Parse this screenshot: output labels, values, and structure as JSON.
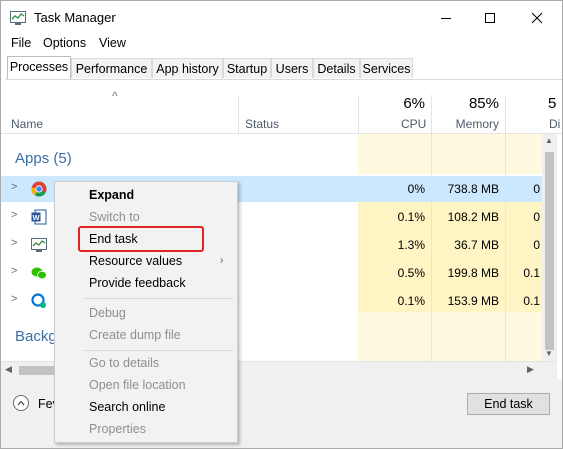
{
  "window": {
    "title": "Task Manager",
    "minimize_glyph": "—",
    "maximize_glyph": "☐",
    "close_glyph": "✕"
  },
  "menu": [
    "File",
    "Options",
    "View"
  ],
  "tabs": [
    "Processes",
    "Performance",
    "App history",
    "Startup",
    "Users",
    "Details",
    "Services"
  ],
  "columns": {
    "sort_glyph": "^",
    "name": "Name",
    "status": "Status",
    "cpu": {
      "pct": "6%",
      "label": "CPU"
    },
    "memory": {
      "pct": "85%",
      "label": "Memory"
    },
    "disk": {
      "pct": "5",
      "label": "Di"
    }
  },
  "groups": {
    "apps": "Apps (5)",
    "background": "Backg"
  },
  "rows": [
    {
      "icon": "chrome-icon",
      "cpu": "0%",
      "memory": "738.8 MB",
      "disk": "0"
    },
    {
      "icon": "word-icon",
      "cpu": "0.1%",
      "memory": "108.2 MB",
      "disk": "0"
    },
    {
      "icon": "task-manager-icon",
      "cpu": "1.3%",
      "memory": "36.7 MB",
      "disk": "0"
    },
    {
      "icon": "wechat-icon",
      "cpu": "0.5%",
      "memory": "199.8 MB",
      "disk": "0.1"
    },
    {
      "icon": "snipping-icon",
      "cpu": "0.1%",
      "memory": "153.9 MB",
      "disk": "0.1"
    }
  ],
  "context_menu": {
    "expand": "Expand",
    "switch_to": "Switch to",
    "end_task": "End task",
    "resource_values": "Resource values",
    "provide_feedback": "Provide feedback",
    "debug": "Debug",
    "create_dump": "Create dump file",
    "go_to_details": "Go to details",
    "open_file_location": "Open file location",
    "search_online": "Search online",
    "properties": "Properties",
    "submenu_arrow": "›"
  },
  "footer": {
    "fewer_details": "Fev",
    "end_task_button": "End task"
  },
  "colors": {
    "accent": "#3c6ea5",
    "selection": "#cce8ff",
    "heat": "#fff4c4",
    "highlight_box": "#e02424"
  }
}
